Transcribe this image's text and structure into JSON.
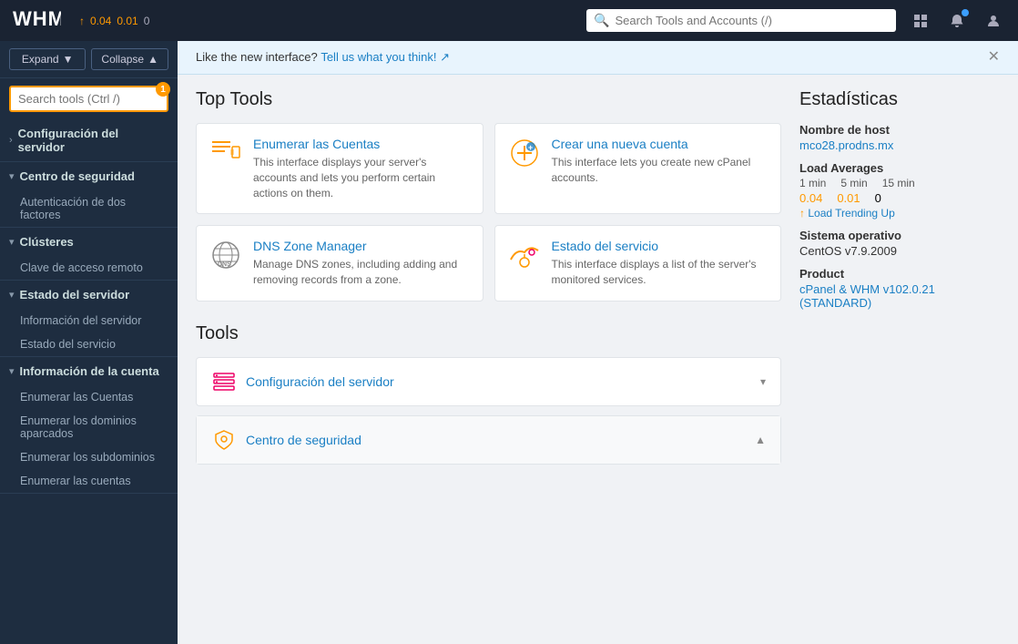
{
  "topbar": {
    "logo": "WHM",
    "load_avg_label": "↑",
    "load_1": "0.04",
    "load_5": "0.01",
    "load_15": "0",
    "search_placeholder": "Search Tools and Accounts (/)"
  },
  "sidebar": {
    "expand_label": "Expand",
    "collapse_label": "Collapse",
    "search_placeholder": "Search tools (Ctrl /)",
    "search_badge": "1",
    "sections": [
      {
        "id": "configuracion",
        "title": "Configuración del servidor",
        "expanded": false,
        "items": []
      },
      {
        "id": "seguridad",
        "title": "Centro de seguridad",
        "expanded": true,
        "items": [
          "Autenticación de dos factores"
        ]
      },
      {
        "id": "clusteres",
        "title": "Clústeres",
        "expanded": true,
        "items": [
          "Clave de acceso remoto"
        ]
      },
      {
        "id": "estado_servidor",
        "title": "Estado del servidor",
        "expanded": true,
        "items": [
          "Información del servidor",
          "Estado del servicio"
        ]
      },
      {
        "id": "info_cuenta",
        "title": "Información de la cuenta",
        "expanded": true,
        "items": [
          "Enumerar las Cuentas",
          "Enumerar los dominios aparcados",
          "Enumerar los subdominios",
          "Enumerar las cuentas"
        ]
      }
    ]
  },
  "banner": {
    "text": "Like the new interface?",
    "link_text": "Tell us what you think! ↗"
  },
  "top_tools": {
    "section_title": "Top Tools",
    "cards": [
      {
        "name": "Enumerar las Cuentas",
        "description": "This interface displays your server's accounts and lets you perform certain actions on them.",
        "icon": "list"
      },
      {
        "name": "Crear una nueva cuenta",
        "description": "This interface lets you create new cPanel accounts.",
        "icon": "plus"
      },
      {
        "name": "DNS Zone Manager",
        "description": "Manage DNS zones, including adding and removing records from a zone.",
        "icon": "dns"
      },
      {
        "name": "Estado del servicio",
        "description": "This interface displays a list of the server's monitored services.",
        "icon": "cloud"
      }
    ]
  },
  "tools_section": {
    "section_title": "Tools",
    "groups": [
      {
        "name": "Configuración del servidor",
        "icon": "server",
        "expanded": false
      },
      {
        "name": "Centro de seguridad",
        "icon": "shield",
        "expanded": true
      }
    ]
  },
  "stats": {
    "section_title": "Estadísticas",
    "hostname_label": "Nombre de host",
    "hostname_value": "mco28.prodns.mx",
    "load_averages_label": "Load Averages",
    "load_time_labels": [
      "1 min",
      "5 min",
      "15 min"
    ],
    "load_values": [
      "0.04",
      "0.01",
      "0"
    ],
    "trend_text": "↑ Load Trending Up",
    "os_label": "Sistema operativo",
    "os_value": "CentOS v7.9.2009",
    "product_label": "Product",
    "product_value": "cPanel & WHM v102.0.21 (STANDARD)"
  }
}
